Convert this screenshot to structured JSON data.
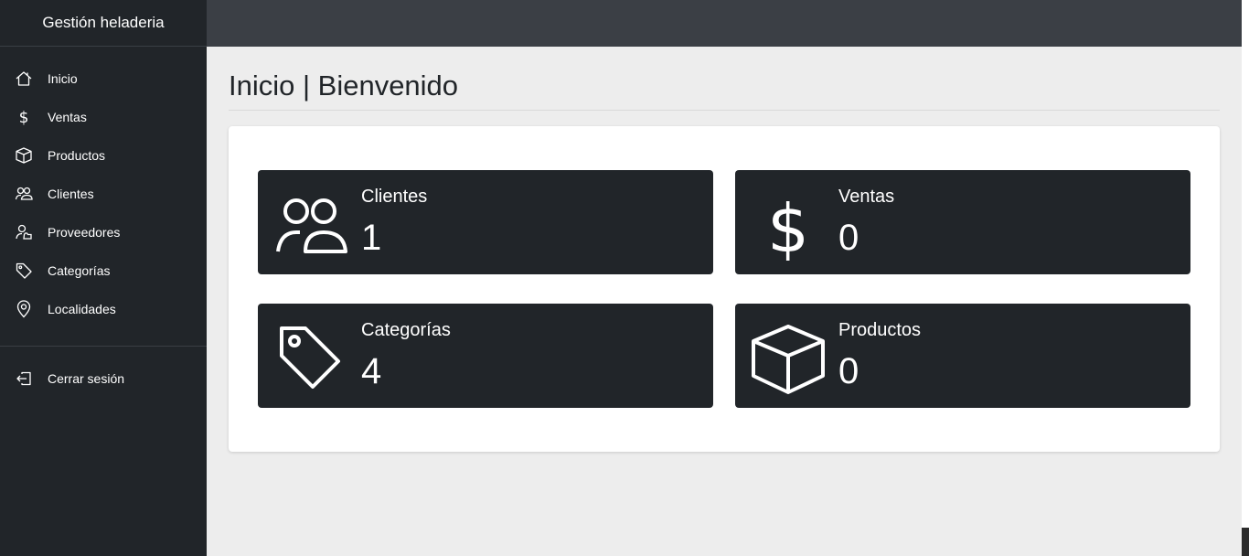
{
  "brand": "Gestión heladeria",
  "sidebar": {
    "items": [
      {
        "label": "Inicio",
        "icon": "house-icon"
      },
      {
        "label": "Ventas",
        "icon": "dollar-icon"
      },
      {
        "label": "Productos",
        "icon": "box-icon"
      },
      {
        "label": "Clientes",
        "icon": "people-icon"
      },
      {
        "label": "Proveedores",
        "icon": "person-badge-icon"
      },
      {
        "label": "Categorías",
        "icon": "tag-icon"
      },
      {
        "label": "Localidades",
        "icon": "geo-pin-icon"
      }
    ],
    "logout": {
      "label": "Cerrar sesión",
      "icon": "box-arrow-left-icon"
    }
  },
  "page": {
    "title": "Inicio | Bienvenido"
  },
  "stats": [
    {
      "label": "Clientes",
      "value": "1",
      "icon": "people-icon"
    },
    {
      "label": "Ventas",
      "value": "0",
      "icon": "dollar-icon"
    },
    {
      "label": "Categorías",
      "value": "4",
      "icon": "tag-icon"
    },
    {
      "label": "Productos",
      "value": "0",
      "icon": "box-icon"
    }
  ],
  "colors": {
    "sidebar_bg": "#212529",
    "topbar_bg": "#3b3f45",
    "tile_bg": "#212529",
    "page_bg": "#ededed"
  }
}
